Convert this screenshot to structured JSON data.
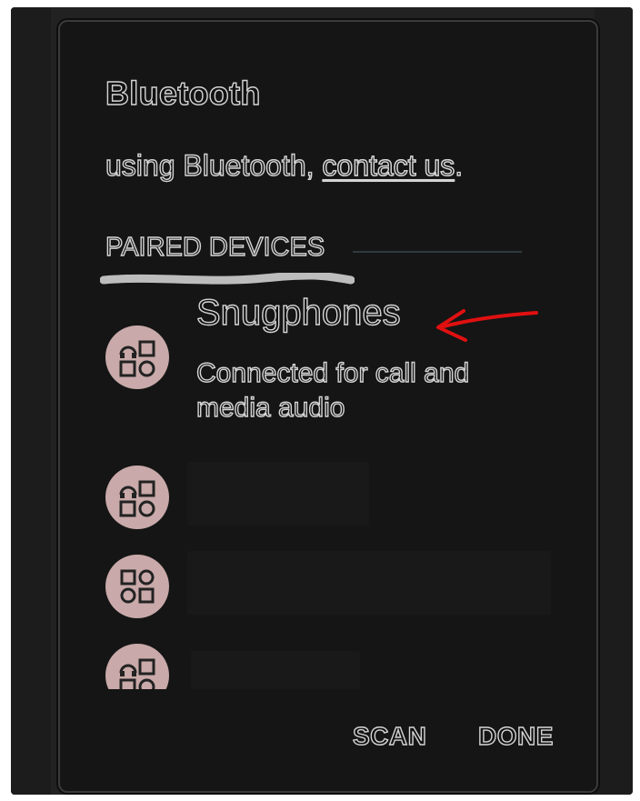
{
  "dialog": {
    "title": "Bluetooth",
    "subtitle_prefix": "using Bluetooth, ",
    "subtitle_link": "contact us",
    "subtitle_suffix": "."
  },
  "section": {
    "header": "PAIRED DEVICES"
  },
  "devices": [
    {
      "name": "Snugphones",
      "status": "Connected for call and media audio",
      "icon": "headset-icon"
    },
    {
      "name": "",
      "status": "",
      "icon": "headset-icon"
    },
    {
      "name": "",
      "status": "",
      "icon": "generic-device-icon"
    },
    {
      "name": "",
      "status": "",
      "icon": "headset-icon"
    }
  ],
  "buttons": {
    "scan": "SCAN",
    "done": "DONE"
  },
  "colors": {
    "background": "#151515",
    "text_outline": "#d4d4d4",
    "icon_circle": "#c9a9a9",
    "annotation_arrow": "#e01010"
  }
}
